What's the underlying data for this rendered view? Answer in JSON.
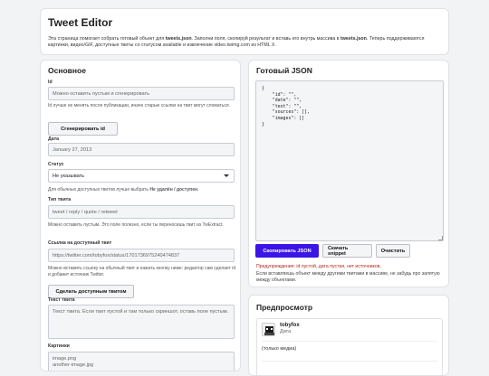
{
  "header": {
    "title": "Tweet Editor",
    "desc_part1": "Эта страница помогает собрать готовый объект для ",
    "desc_bold1": "tweets.json",
    "desc_part2": ". Заполни поля, скопируй результат и вставь его внутрь массива в ",
    "desc_bold2": "tweets.json",
    "desc_part3": ". Теперь поддерживаются картинки, видео/GIF, доступные твиты со статусом available и извлечение video.twimg.com из HTML X."
  },
  "left": {
    "heading": "Основное",
    "id_label": "Id",
    "id_placeholder": "Можно оставить пустым и сгенерировать",
    "id_hint": "Id лучше не менять после публикации, иначе старые ссылки на твит могут сломаться.",
    "gen_id_button": "Сгенерировать id",
    "date_label": "Дата",
    "date_value": "January 27, 2013",
    "status_label": "Статус",
    "status_value": "Не указывать",
    "status_hint_part1": "Для обычных доступных твитов лучше выбрать ",
    "status_hint_bold": "Не удалён / доступен",
    "status_hint_part2": ".",
    "type_label": "Тип твита",
    "type_placeholder": "tweet / reply / quote / retweet",
    "type_hint": "Можно оставить пустым. Это поле полезно, если ты переносишь твит из TwExtract.",
    "link_label": "Ссылка на доступный твит",
    "link_placeholder": "https://twitter.com/tobyfox/status/1701736975240474837",
    "link_hint": "Можно вставить ссылку на обычный твит и нажать кнопку ниже: редактор сам сделает id и добавит источник Twitter.",
    "make_available_button": "Сделать доступным твитом",
    "text_label": "Текст твита",
    "text_placeholder": "Текст твита. Если твит пустой и там только скриншот, оставь поле пустым.",
    "images_label": "Картинки",
    "images_placeholder": "image.png\nanother-image.jpg"
  },
  "json_panel": {
    "heading": "Готовый JSON",
    "code": "{\n    \"id\": \"\",\n    \"date\": \"\",\n    \"text\": \"\",\n    \"sources\": [],\n    \"images\": []\n}",
    "copy_button": "Скопировать JSON",
    "download_button": "Скачать snippet",
    "clear_button": "Очистить",
    "warning": "Предупреждения: id пустой, дата пустая, нет источников.",
    "note": "Если вставляешь объект между другими твитами в массиве, не забудь про запятую между объектами."
  },
  "preview": {
    "heading": "Предпросмотр",
    "user": "tobyfox",
    "date": "Дата",
    "media_text": "(только медиа)"
  }
}
